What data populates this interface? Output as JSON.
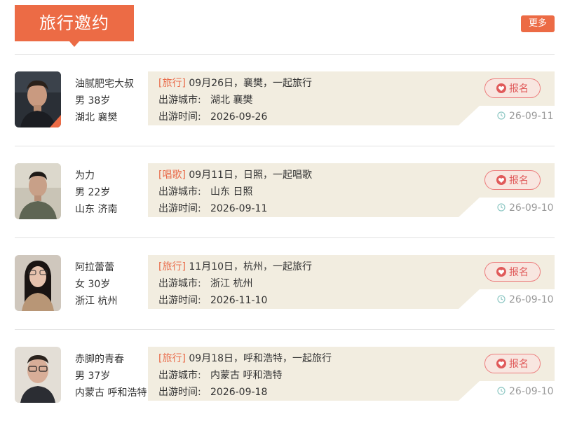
{
  "header": {
    "title": "旅行邀约",
    "more_label": "更多"
  },
  "colors": {
    "accent": "#ec6b45",
    "panel_bg": "#f2ede0",
    "tag": "#e96b4a",
    "signup_border": "#ec7d7d",
    "clock": "#8fc8c4"
  },
  "labels": {
    "city_label": "出游城市:",
    "time_label": "出游时间:",
    "signup_label": "报名"
  },
  "items": [
    {
      "name": "油腻肥宅大叔",
      "gender_age": "男 38岁",
      "location": "湖北 襄樊",
      "tag": "[旅行]",
      "invite_text": "09月26日，襄樊，一起旅行",
      "city": "湖北 襄樊",
      "time": "2026-09-26",
      "posted": "26-09-11",
      "avatar_icon": "man-portrait-dark"
    },
    {
      "name": "为力",
      "gender_age": "男 22岁",
      "location": "山东 济南",
      "tag": "[唱歌]",
      "invite_text": "09月11日，日照，一起唱歌",
      "city": "山东 日照",
      "time": "2026-09-11",
      "posted": "26-09-10",
      "avatar_icon": "young-man-portrait"
    },
    {
      "name": "阿拉蕾蕾",
      "gender_age": "女 30岁",
      "location": "浙江 杭州",
      "tag": "[旅行]",
      "invite_text": "11月10日，杭州，一起旅行",
      "city": "浙江 杭州",
      "time": "2026-11-10",
      "posted": "26-09-10",
      "avatar_icon": "woman-portrait"
    },
    {
      "name": "赤脚的青春",
      "gender_age": "男 37岁",
      "location": "内蒙古 呼和浩特",
      "tag": "[旅行]",
      "invite_text": "09月18日，呼和浩特，一起旅行",
      "city": "内蒙古 呼和浩特",
      "time": "2026-09-18",
      "posted": "26-09-10",
      "avatar_icon": "man-glasses-portrait"
    }
  ]
}
